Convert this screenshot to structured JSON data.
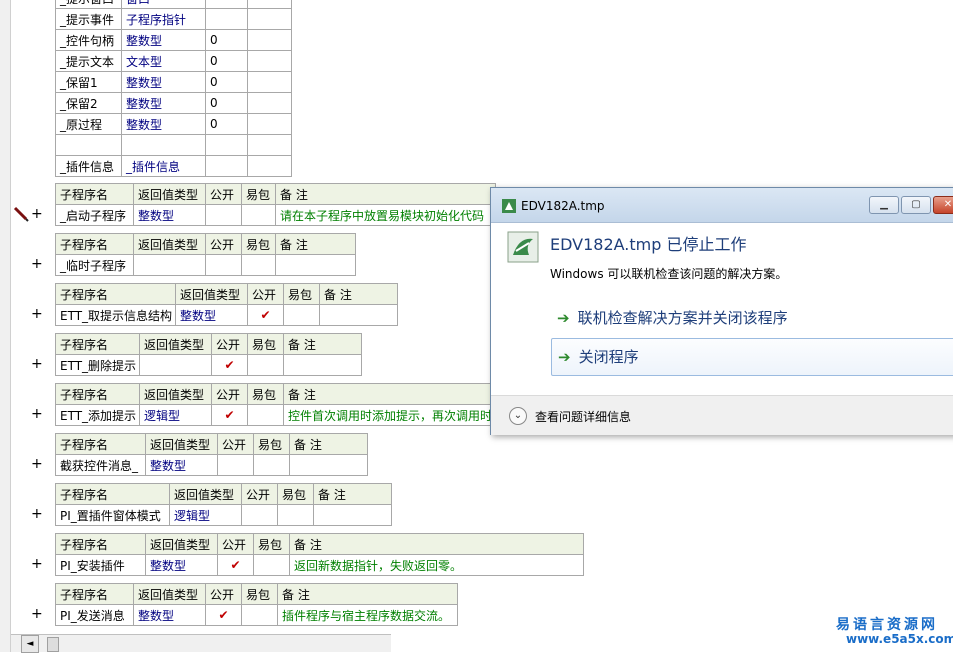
{
  "var_table": {
    "rows": [
      {
        "name": "_提示窗口",
        "type": "窗口",
        "val": ""
      },
      {
        "name": "_提示事件",
        "type": "子程序指针",
        "val": ""
      },
      {
        "name": "_控件句柄",
        "type": "整数型",
        "val": "0"
      },
      {
        "name": "_提示文本",
        "type": "文本型",
        "val": "0"
      },
      {
        "name": "_保留1",
        "type": "整数型",
        "val": "0"
      },
      {
        "name": "_保留2",
        "type": "整数型",
        "val": "0"
      },
      {
        "name": "_原过程",
        "type": "整数型",
        "val": "0"
      },
      {
        "name": "",
        "type": "",
        "val": ""
      },
      {
        "name": "_插件信息",
        "type": "_插件信息",
        "val": ""
      }
    ]
  },
  "headers": {
    "name": "子程序名",
    "ret": "返回值类型",
    "public": "公开",
    "easy": "易包",
    "note": "备 注"
  },
  "subs": [
    {
      "name": "_启动子程序",
      "ret": "整数型",
      "public": "",
      "note": "请在本子程序中放置易模块初始化代码"
    },
    {
      "name": "_临时子程序",
      "ret": "",
      "public": "",
      "note": ""
    },
    {
      "name": "ETT_取提示信息结构",
      "ret": "整数型",
      "public": "✔",
      "note": ""
    },
    {
      "name": "ETT_删除提示",
      "ret": "",
      "public": "✔",
      "note": ""
    },
    {
      "name": "ETT_添加提示",
      "ret": "逻辑型",
      "public": "✔",
      "note": "控件首次调用时添加提示，再次调用时"
    },
    {
      "name": "截获控件消息_",
      "ret": "整数型",
      "public": "",
      "note": ""
    },
    {
      "name": "PI_置插件窗体模式",
      "ret": "逻辑型",
      "public": "",
      "note": ""
    },
    {
      "name": "PI_安装插件",
      "ret": "整数型",
      "public": "✔",
      "note": "返回新数据指针，失败返回零。"
    },
    {
      "name": "PI_发送消息",
      "ret": "整数型",
      "public": "✔",
      "note": "插件程序与宿主程序数据交流。"
    }
  ],
  "gutter": {
    "plus": "+"
  },
  "dialog": {
    "title": "EDV182A.tmp",
    "headline": "EDV182A.tmp 已停止工作",
    "subline": "Windows 可以联机检查该问题的解决方案。",
    "option1": "联机检查解决方案并关闭该程序",
    "option2": "关闭程序",
    "arrow": "➔",
    "details": "查看问题详细信息",
    "minimize": "▁",
    "maximize": "▢",
    "close": "✕",
    "chevron": "⌄"
  },
  "scrollbar": {
    "left_arrow": "◄"
  },
  "watermark": {
    "line1": "易语言资源网",
    "line2": "www.e5a5x.com"
  },
  "colors": {
    "accent": "#1e3e7a",
    "note_green": "#008000",
    "type_blue": "#000080",
    "check_red": "#c00000"
  }
}
